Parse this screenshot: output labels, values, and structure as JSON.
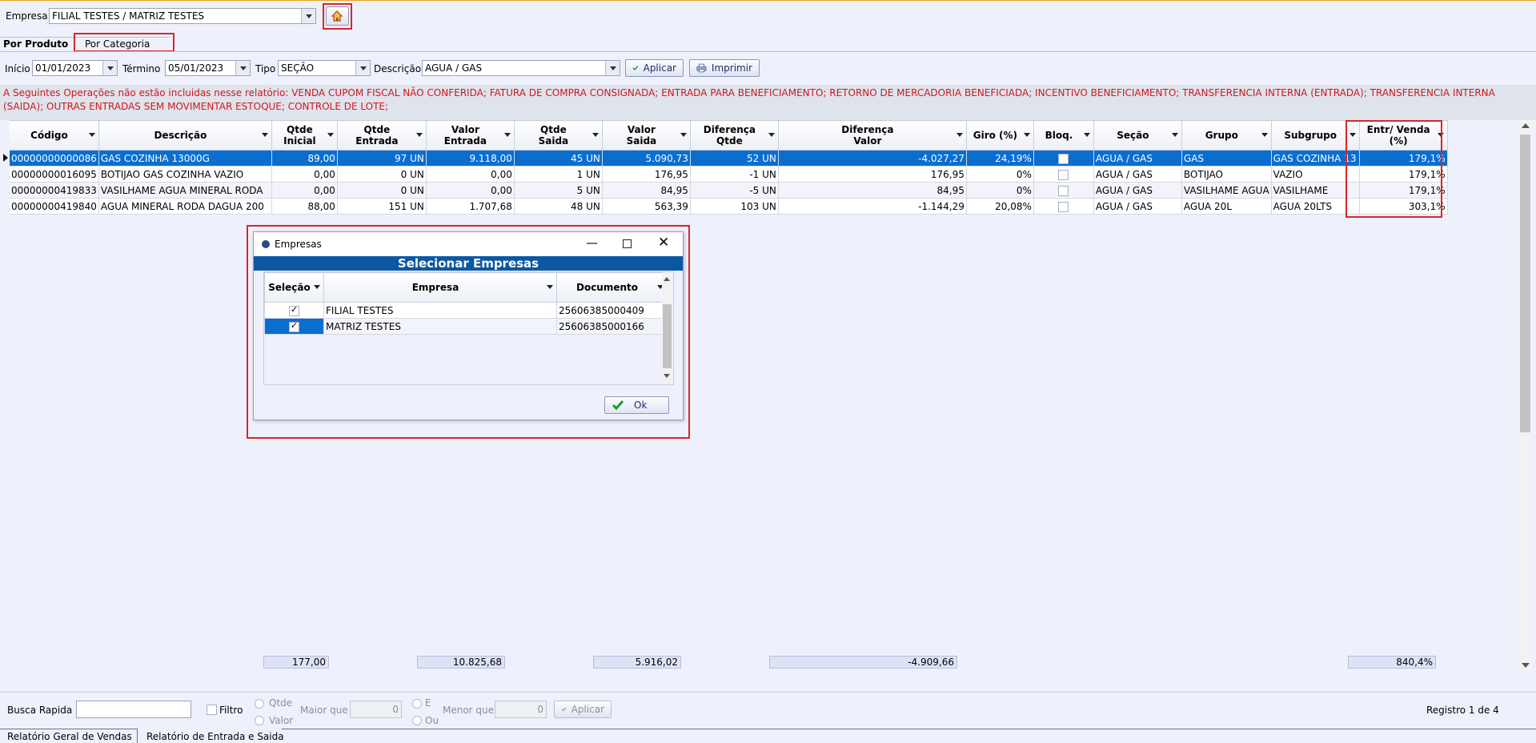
{
  "header": {
    "empresa_label": "Empresa",
    "empresa_value": "FILIAL TESTES / MATRIZ TESTES"
  },
  "tabs": [
    {
      "label": "Por Produto",
      "active": true
    },
    {
      "label": "Por Categoria",
      "active": false
    }
  ],
  "filters": {
    "inicio_label": "Início",
    "inicio_value": "01/01/2023",
    "termino_label": "Término",
    "termino_value": "05/01/2023",
    "tipo_label": "Tipo",
    "tipo_value": "SEÇÃO",
    "descricao_label": "Descrição",
    "descricao_value": "AGUA / GAS",
    "aplicar_label": "Aplicar",
    "imprimir_label": "Imprimir"
  },
  "warning": "A Seguintes Operações não estão incluidas nesse relatório: VENDA CUPOM FISCAL NÃO CONFERIDA; FATURA DE COMPRA CONSIGNADA; ENTRADA PARA BENEFICIAMENTO; RETORNO DE MERCADORIA BENEFICIADA; INCENTIVO BENEFICIAMENTO; TRANSFERENCIA INTERNA (ENTRADA); TRANSFERENCIA INTERNA (SAIDA); OUTRAS ENTRADAS SEM MOVIMENTAR ESTOQUE; CONTROLE DE LOTE;",
  "grid": {
    "columns": [
      [
        "Código"
      ],
      [
        "Descrição"
      ],
      [
        "Qtde Inicial"
      ],
      [
        "Qtde",
        "Entrada"
      ],
      [
        "Valor",
        "Entrada"
      ],
      [
        "Qtde",
        "Saida"
      ],
      [
        "Valor",
        "Saida"
      ],
      [
        "Diferença",
        "Qtde"
      ],
      [
        "Diferença",
        "Valor"
      ],
      [
        "Giro (%)"
      ],
      [
        "Bloq."
      ],
      [
        "Seção"
      ],
      [
        "Grupo"
      ],
      [
        "Subgrupo"
      ],
      [
        "Entr/ Venda",
        "(%)"
      ]
    ],
    "rows": [
      [
        "00000000000086",
        "GAS COZINHA 13000G",
        "89,00",
        "97 UN",
        "9.118,00",
        "45 UN",
        "5.090,73",
        "52 UN",
        "-4.027,27",
        "24,19%",
        "",
        "AGUA / GAS",
        "GAS",
        "GAS COZINHA 13",
        "179,1%"
      ],
      [
        "00000000016095",
        "BOTIJAO GAS COZINHA VAZIO",
        "0,00",
        "0 UN",
        "0,00",
        "1 UN",
        "176,95",
        "-1 UN",
        "176,95",
        "0%",
        "",
        "AGUA / GAS",
        "BOTIJAO",
        "VAZIO",
        "179,1%"
      ],
      [
        "00000000419833",
        "VASILHAME AGUA MINERAL RODA",
        "0,00",
        "0 UN",
        "0,00",
        "5 UN",
        "84,95",
        "-5 UN",
        "84,95",
        "0%",
        "",
        "AGUA / GAS",
        "VASILHAME AGUA",
        "VASILHAME",
        "179,1%"
      ],
      [
        "00000000419840",
        "AGUA MINERAL RODA DAGUA 200",
        "88,00",
        "151 UN",
        "1.707,68",
        "48 UN",
        "563,39",
        "103 UN",
        "-1.144,29",
        "20,08%",
        "",
        "AGUA / GAS",
        "AGUA 20L",
        "AGUA 20LTS",
        "303,1%"
      ]
    ],
    "totals": {
      "qtde_inicial": "177,00",
      "valor_entrada": "10.825,68",
      "valor_saida": "5.916,02",
      "diferenca_valor": "-4.909,66",
      "entr_venda": "840,4%"
    }
  },
  "dialog": {
    "title": "Empresas",
    "banner": "Selecionar Empresas",
    "columns": [
      "Seleção",
      "Empresa",
      "Documento"
    ],
    "rows": [
      {
        "empresa": "FILIAL TESTES",
        "documento": "25606385000409",
        "checked": true
      },
      {
        "empresa": "MATRIZ TESTES",
        "documento": "25606385000166",
        "checked": true
      }
    ],
    "ok_label": "Ok"
  },
  "bottom": {
    "busca_label": "Busca Rapida",
    "filtro_label": "Filtro",
    "qtde_label": "Qtde",
    "valor_label": "Valor",
    "maior_label": "Maior que",
    "maior_value": "0",
    "e_label": "E",
    "ou_label": "Ou",
    "menor_label": "Menor que",
    "menor_value": "0",
    "aplicar_label": "Aplicar",
    "registro": "Registro 1 de 4"
  },
  "bottom_tabs": [
    "Relatório Geral de Vendas",
    "Relatório de Entrada e Saida"
  ]
}
